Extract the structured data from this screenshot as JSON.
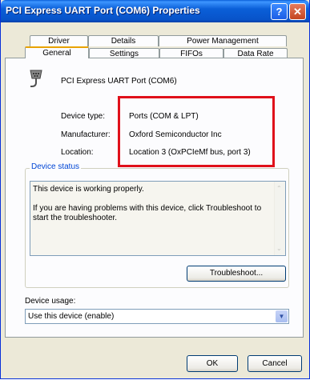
{
  "window": {
    "title": "PCI Express UART Port (COM6) Properties",
    "help_glyph": "?",
    "close_glyph": "✕"
  },
  "tabs_back": [
    "Driver",
    "Details",
    "Power Management"
  ],
  "tabs_front": [
    "General",
    "Settings",
    "FIFOs",
    "Data Rate"
  ],
  "active_tab": "General",
  "device": {
    "name": "PCI Express UART Port (COM6)",
    "icon": "serial-port-icon",
    "fields": [
      {
        "label": "Device type:",
        "value": "Ports (COM & LPT)"
      },
      {
        "label": "Manufacturer:",
        "value": "Oxford Semiconductor Inc"
      },
      {
        "label": "Location:",
        "value": "Location 3 (OxPCIeMf bus, port 3)"
      }
    ]
  },
  "device_status": {
    "legend": "Device status",
    "line1": "This device is working properly.",
    "line2": "If you are having problems with this device, click Troubleshoot to start the troubleshooter.",
    "troubleshoot_label": "Troubleshoot..."
  },
  "device_usage": {
    "label": "Device usage:",
    "selected": "Use this device (enable)"
  },
  "footer": {
    "ok_label": "OK",
    "cancel_label": "Cancel"
  },
  "colors": {
    "title_bar": "#0a5fd8",
    "highlight": "#e0101a",
    "group_legend": "#0046d5"
  }
}
